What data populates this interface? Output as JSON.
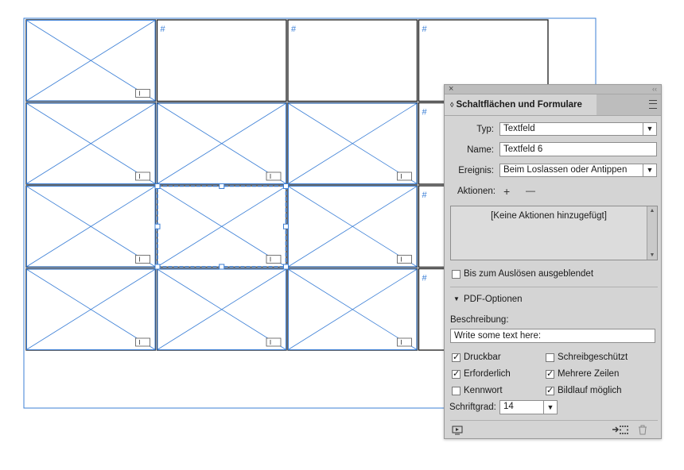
{
  "panel": {
    "title": "Schaltflächen und Formulare",
    "close_glyph": "×",
    "collapse_glyph": "‹‹",
    "sort_glyph": "◊",
    "typ_label": "Typ:",
    "typ_value": "Textfeld",
    "name_label": "Name:",
    "name_value": "Textfeld 6",
    "ereignis_label": "Ereignis:",
    "ereignis_value": "Beim Loslassen oder Antippen",
    "aktionen_label": "Aktionen:",
    "add_glyph": "+",
    "remove_glyph": "—",
    "actions_empty": "[Keine Aktionen hinzugefügt]",
    "hidden_label": "Bis zum Auslösen ausgeblendet",
    "pdf_section": "PDF-Optionen",
    "beschreibung_label": "Beschreibung:",
    "beschreibung_value": "Write some text here:",
    "checkboxes": [
      {
        "label": "Druckbar",
        "checked": true
      },
      {
        "label": "Schreibgeschützt",
        "checked": false
      },
      {
        "label": "Erforderlich",
        "checked": true
      },
      {
        "label": "Mehrere Zeilen",
        "checked": true
      },
      {
        "label": "Kennwort",
        "checked": false
      },
      {
        "label": "Bildlauf möglich",
        "checked": true
      }
    ],
    "schriftgrad_label": "Schriftgrad:",
    "schriftgrad_value": "14",
    "dropdown_arrow": "▼",
    "collapse_arrow": "▼",
    "check_mark": "✓",
    "footer_icons": [
      "preview-icon",
      "convert-to-button-icon",
      "trash-icon"
    ]
  },
  "canvas": {
    "grid_rows": 4,
    "grid_cols": 4,
    "placeholder_cells": [
      [
        0,
        0
      ],
      [
        1,
        0
      ],
      [
        1,
        1
      ],
      [
        1,
        2
      ],
      [
        2,
        0
      ],
      [
        2,
        1
      ],
      [
        2,
        2
      ],
      [
        3,
        0
      ],
      [
        3,
        1
      ],
      [
        3,
        2
      ]
    ],
    "hash_cells": [
      [
        0,
        1
      ],
      [
        0,
        2
      ],
      [
        0,
        3
      ],
      [
        1,
        3
      ],
      [
        2,
        3
      ],
      [
        3,
        3
      ]
    ],
    "hash_glyph": "#",
    "selected_cell": [
      2,
      1
    ],
    "line_color": "#3b7fd6",
    "frame_color": "#1a1a1a"
  }
}
